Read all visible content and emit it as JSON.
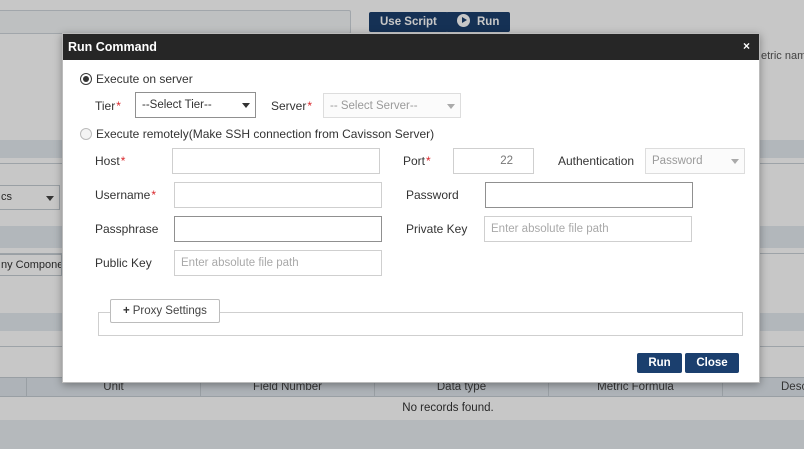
{
  "background": {
    "toolbar": {
      "use_script_label": "Use Script",
      "run_label": "Run"
    },
    "select_partial": "cs",
    "component_partial": "ny Compone",
    "metric_partial": "etric nam",
    "table": {
      "columns": [
        "Unit",
        "Field Number",
        "Data type",
        "Metric Formula",
        "Desc"
      ],
      "empty_message": "No records found."
    }
  },
  "dialog": {
    "title": "Run Command",
    "close_symbol": "×",
    "execute_server_label": "Execute on server",
    "tier": {
      "label": "Tier",
      "required": "*",
      "value": "--Select Tier--"
    },
    "server": {
      "label": "Server",
      "required": "*",
      "value": "-- Select Server--"
    },
    "execute_remote_label": "Execute remotely(Make SSH connection from Cavisson Server)",
    "host": {
      "label": "Host",
      "required": "*",
      "value": ""
    },
    "port": {
      "label": "Port",
      "required": "*",
      "value": "22"
    },
    "authentication": {
      "label": "Authentication",
      "value": "Password"
    },
    "username": {
      "label": "Username",
      "required": "*",
      "value": ""
    },
    "password": {
      "label": "Password",
      "value": ""
    },
    "passphrase": {
      "label": "Passphrase",
      "value": ""
    },
    "private_key": {
      "label": "Private Key",
      "placeholder": "Enter absolute file path"
    },
    "public_key": {
      "label": "Public Key",
      "placeholder": "Enter absolute file path"
    },
    "proxy_settings_label": "Proxy Settings",
    "run_label": "Run",
    "close_label": "Close"
  },
  "colors": {
    "header_bg": "#262626",
    "button_bg": "#1b3f6e",
    "required": "#d9262b"
  },
  "icons": {
    "close": "close-icon",
    "play": "play-icon",
    "plus": "plus-icon",
    "dropdown": "chevron-down-icon"
  }
}
